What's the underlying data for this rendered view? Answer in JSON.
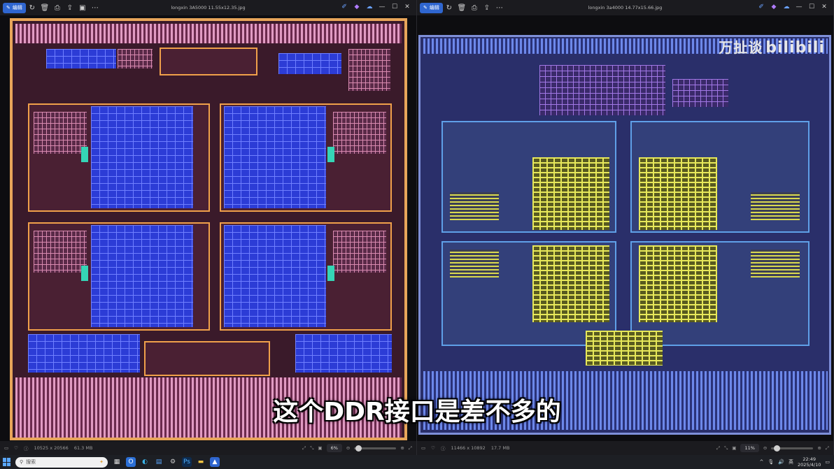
{
  "left_viewer": {
    "edit_label": "编辑",
    "title": "longxin 3A5000 11.55x12.35.jpg",
    "dimensions": "10525 x 20566",
    "filesize": "61.3 MB",
    "zoom": "6%"
  },
  "right_viewer": {
    "edit_label": "编辑",
    "title": "longxin 3a4000 14.77x15.66.jpg",
    "dimensions": "11466 x 10892",
    "filesize": "17.7 MB",
    "zoom": "11%"
  },
  "watermark": {
    "text": "万扯谈",
    "logo": "bilibili"
  },
  "subtitle": "这个DDR接口是差不多的",
  "taskbar": {
    "search_placeholder": "搜索",
    "time": "22:49",
    "date": "2025/4/10",
    "ime": "英"
  },
  "colors": {
    "accent": "#2f66d0",
    "left_die_frame": "#e8a55a",
    "right_die_frame": "#7e8fd8",
    "cache_blue": "#2c3cd6",
    "cache_yellow": "#e7e85a"
  },
  "icons": {
    "toolbar": [
      "rotate-icon",
      "delete-icon",
      "print-icon",
      "share-icon",
      "slideshow-icon",
      "more-icon"
    ],
    "status": [
      "screen-icon",
      "heart-icon",
      "info-icon",
      "fit-icon",
      "zoom-out-icon",
      "zoom-in-icon",
      "fullscreen-icon"
    ]
  }
}
